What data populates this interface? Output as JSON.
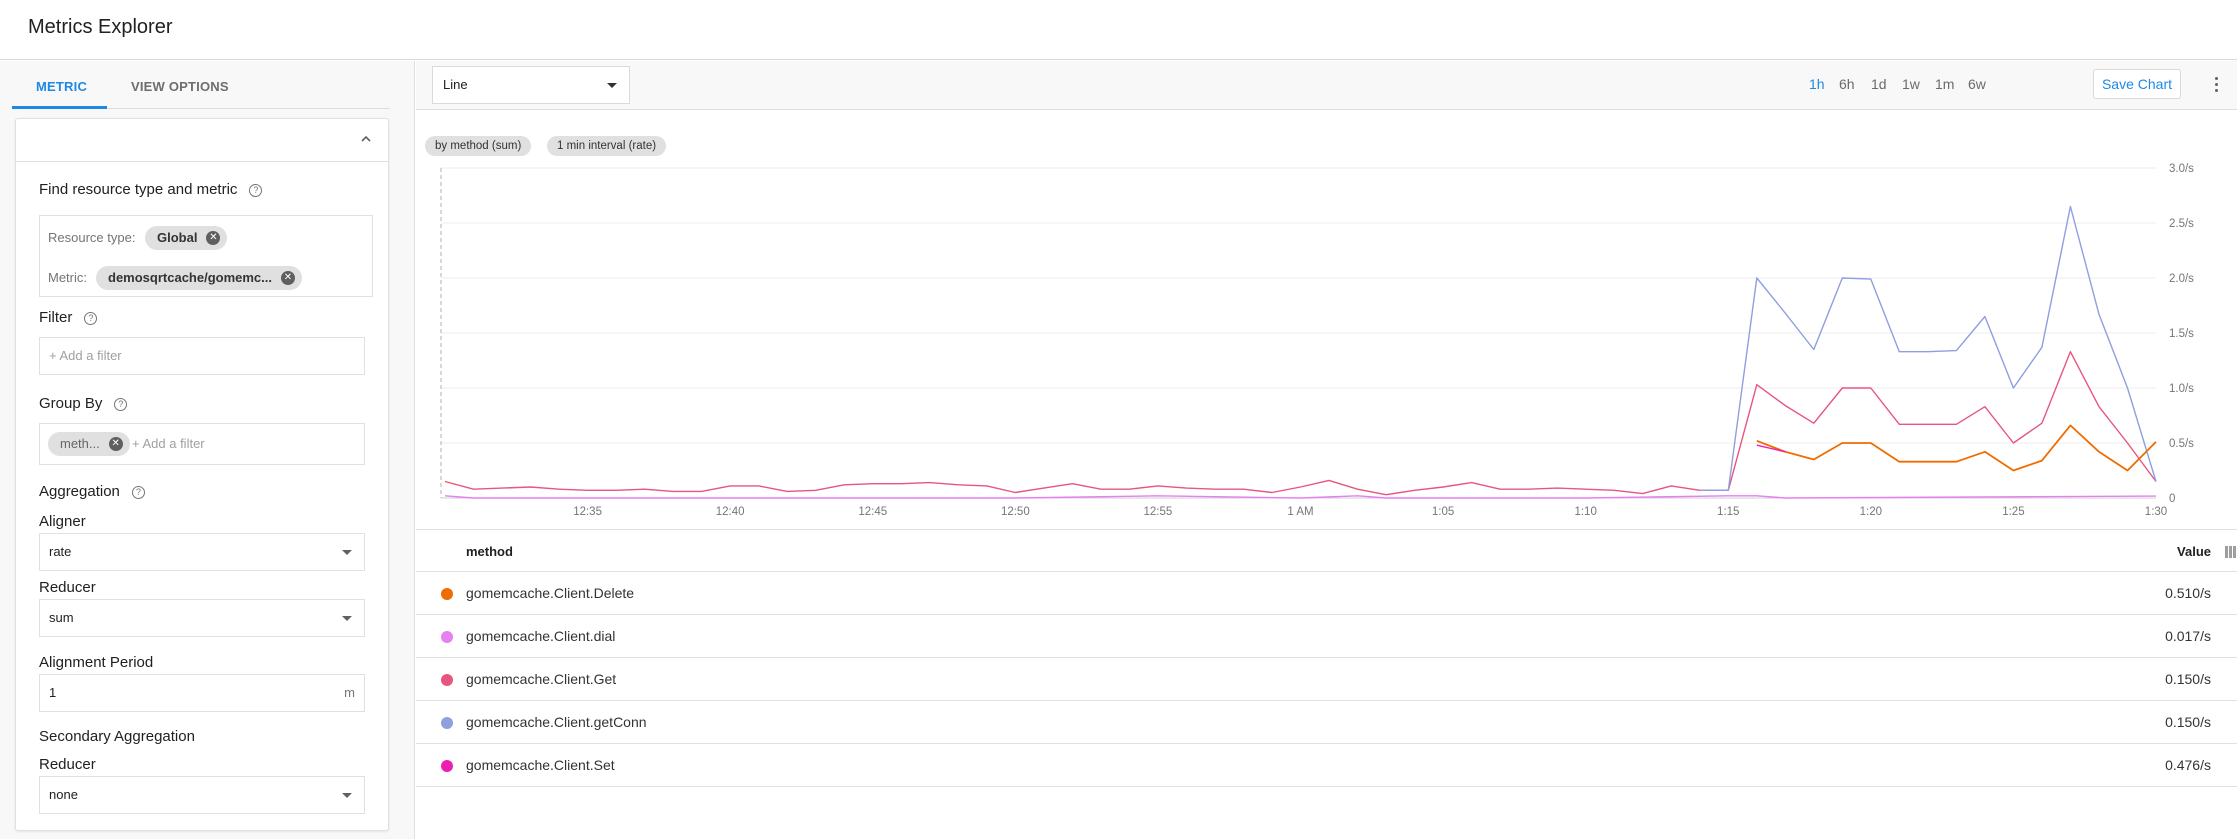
{
  "header": {
    "title": "Metrics Explorer"
  },
  "left_panel": {
    "tabs": [
      {
        "label": "METRIC",
        "active": true
      },
      {
        "label": "VIEW OPTIONS",
        "active": false
      }
    ],
    "find_section": {
      "label": "Find resource type and metric",
      "resource_type_label": "Resource type:",
      "resource_type_value": "Global",
      "metric_label": "Metric:",
      "metric_value": "demosqrtcache/gomemc..."
    },
    "filter": {
      "label": "Filter",
      "placeholder": "+ Add a filter"
    },
    "group_by": {
      "label": "Group By",
      "chip": "meth...",
      "placeholder": "+ Add a filter"
    },
    "aggregation": {
      "label": "Aggregation",
      "aligner_label": "Aligner",
      "aligner_value": "rate",
      "reducer_label": "Reducer",
      "reducer_value": "sum",
      "period_label": "Alignment Period",
      "period_value": "1",
      "period_unit": "m"
    },
    "secondary": {
      "label": "Secondary Aggregation",
      "reducer_label": "Reducer",
      "reducer_value": "none"
    }
  },
  "toolbar": {
    "chart_type": "Line",
    "ranges": [
      "1h",
      "6h",
      "1d",
      "1w",
      "1m",
      "6w"
    ],
    "active_range": "1h",
    "save_label": "Save Chart"
  },
  "pills": [
    "by method (sum)",
    "1 min interval (rate)"
  ],
  "table": {
    "col_method": "method",
    "col_value": "Value",
    "rows": [
      {
        "name": "gomemcache.Client.Delete",
        "value": "0.510/s",
        "color": "#ef6c00"
      },
      {
        "name": "gomemcache.Client.dial",
        "value": "0.017/s",
        "color": "#e67ff0"
      },
      {
        "name": "gomemcache.Client.Get",
        "value": "0.150/s",
        "color": "#e8557e"
      },
      {
        "name": "gomemcache.Client.getConn",
        "value": "0.150/s",
        "color": "#8f9fdf"
      },
      {
        "name": "gomemcache.Client.Set",
        "value": "0.476/s",
        "color": "#ec1fb2"
      }
    ]
  },
  "chart_data": {
    "type": "line",
    "title": "",
    "xlabel": "",
    "ylabel": "",
    "x_unit": "minutes after 12:30",
    "x_range": [
      0,
      60
    ],
    "x_ticks": [
      {
        "at": 5,
        "label": "12:35"
      },
      {
        "at": 10,
        "label": "12:40"
      },
      {
        "at": 15,
        "label": "12:45"
      },
      {
        "at": 20,
        "label": "12:50"
      },
      {
        "at": 25,
        "label": "12:55"
      },
      {
        "at": 30,
        "label": "1 AM"
      },
      {
        "at": 35,
        "label": "1:05"
      },
      {
        "at": 40,
        "label": "1:10"
      },
      {
        "at": 45,
        "label": "1:15"
      },
      {
        "at": 50,
        "label": "1:20"
      },
      {
        "at": 55,
        "label": "1:25"
      },
      {
        "at": 60,
        "label": "1:30"
      }
    ],
    "ylim": [
      0,
      3.0
    ],
    "y_ticks": [
      {
        "v": 0,
        "label": "0"
      },
      {
        "v": 0.5,
        "label": "0.5/s"
      },
      {
        "v": 1.0,
        "label": "1.0/s"
      },
      {
        "v": 1.5,
        "label": "1.5/s"
      },
      {
        "v": 2.0,
        "label": "2.0/s"
      },
      {
        "v": 2.5,
        "label": "2.5/s"
      },
      {
        "v": 3.0,
        "label": "3.0/s"
      }
    ],
    "grid": true,
    "legend": "table-below",
    "series": [
      {
        "name": "gomemcache.Client.Get",
        "color": "#e8557e",
        "x": [
          0,
          1,
          2,
          3,
          4,
          5,
          6,
          7,
          8,
          9,
          10,
          11,
          12,
          13,
          14,
          15,
          16,
          17,
          18,
          19,
          20,
          21,
          22,
          23,
          24,
          25,
          26,
          27,
          28,
          29,
          30,
          31,
          32,
          33,
          34,
          35,
          36,
          37,
          38,
          39,
          40,
          41,
          42,
          43,
          44,
          45,
          46,
          47,
          48,
          49,
          50,
          51,
          52,
          53,
          54,
          55,
          56,
          57,
          58,
          59,
          60
        ],
        "values": [
          0.15,
          0.08,
          0.09,
          0.1,
          0.08,
          0.07,
          0.07,
          0.08,
          0.06,
          0.06,
          0.11,
          0.11,
          0.06,
          0.07,
          0.12,
          0.13,
          0.13,
          0.14,
          0.12,
          0.11,
          0.05,
          0.09,
          0.13,
          0.08,
          0.08,
          0.11,
          0.09,
          0.08,
          0.08,
          0.05,
          0.1,
          0.16,
          0.08,
          0.03,
          0.07,
          0.1,
          0.14,
          0.08,
          0.08,
          0.09,
          0.08,
          0.07,
          0.04,
          0.11,
          0.07,
          0.07,
          1.03,
          0.84,
          0.68,
          1.0,
          1.0,
          0.67,
          0.67,
          0.67,
          0.83,
          0.5,
          0.68,
          1.33,
          0.83,
          0.5,
          0.15
        ]
      },
      {
        "name": "gomemcache.Client.getConn",
        "color": "#8f9fdf",
        "x": [
          44,
          45,
          46,
          47,
          48,
          49,
          50,
          51,
          52,
          53,
          54,
          55,
          56,
          57,
          58,
          59,
          60
        ],
        "values": [
          0.07,
          0.07,
          2.0,
          1.68,
          1.35,
          2.0,
          1.99,
          1.33,
          1.33,
          1.34,
          1.65,
          1.0,
          1.37,
          2.65,
          1.67,
          1.0,
          0.15
        ]
      },
      {
        "name": "gomemcache.Client.Delete",
        "color": "#ef6c00",
        "x": [
          46,
          47,
          48,
          49,
          50,
          51,
          52,
          53,
          54,
          55,
          56,
          57,
          58,
          59,
          60
        ],
        "values": [
          0.52,
          0.42,
          0.35,
          0.5,
          0.5,
          0.33,
          0.33,
          0.33,
          0.42,
          0.25,
          0.34,
          0.66,
          0.42,
          0.25,
          0.51
        ]
      },
      {
        "name": "gomemcache.Client.Set",
        "color": "#ec1fb2",
        "x": [
          46,
          47
        ],
        "values": [
          0.48,
          0.42
        ]
      },
      {
        "name": "gomemcache.Client.dial",
        "color": "#e67ff0",
        "x": [
          0,
          1,
          2,
          10,
          20,
          25,
          30,
          32,
          33,
          40,
          45,
          46,
          47,
          60
        ],
        "values": [
          0.02,
          0.0,
          0.0,
          0.0,
          0.0,
          0.02,
          0.0,
          0.02,
          0.0,
          0.0,
          0.02,
          0.02,
          0.0,
          0.017
        ]
      }
    ]
  }
}
